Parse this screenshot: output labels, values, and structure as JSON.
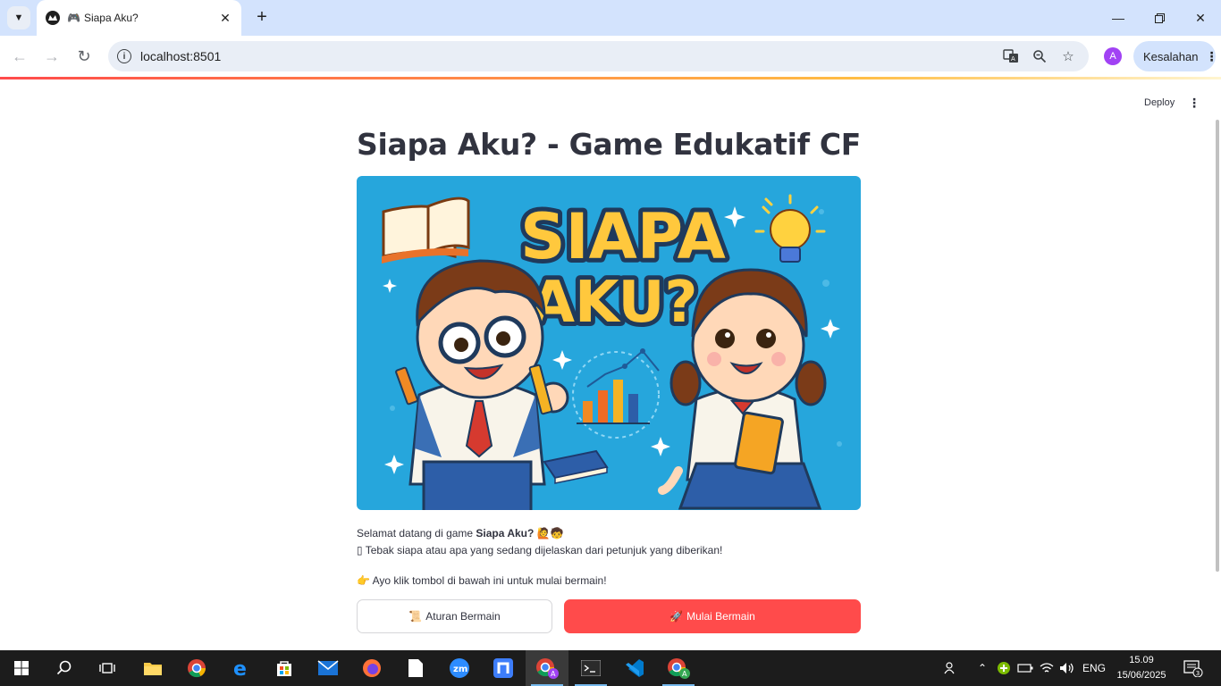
{
  "browser": {
    "tab_title": "Siapa Aku?",
    "tab_emoji": "🎮",
    "url": "localhost:8501",
    "profile_initial": "A",
    "error_chip": "Kesalahan"
  },
  "app": {
    "deploy_label": "Deploy",
    "title": "Siapa Aku? - Game Edukatif CF",
    "hero": {
      "line1": "SIAPA",
      "line2": "AKU?"
    },
    "welcome_prefix": "Selamat datang di game ",
    "welcome_bold": "Siapa Aku?",
    "welcome_emoji": "🙋🧒",
    "hint_icon": "▯",
    "hint_text": "Tebak siapa atau apa yang sedang dijelaskan dari petunjuk yang diberikan!",
    "cta_icon": "👉",
    "cta_text": "Ayo klik tombol di bawah ini untuk mulai bermain!",
    "rules_icon": "📜",
    "rules_button": "Aturan Bermain",
    "start_icon": "🚀",
    "start_button": "Mulai Bermain",
    "accent_color": "#ff4b4b"
  },
  "taskbar": {
    "language": "ENG",
    "time": "15.09",
    "date": "15/06/2025",
    "notification_count": "3"
  }
}
